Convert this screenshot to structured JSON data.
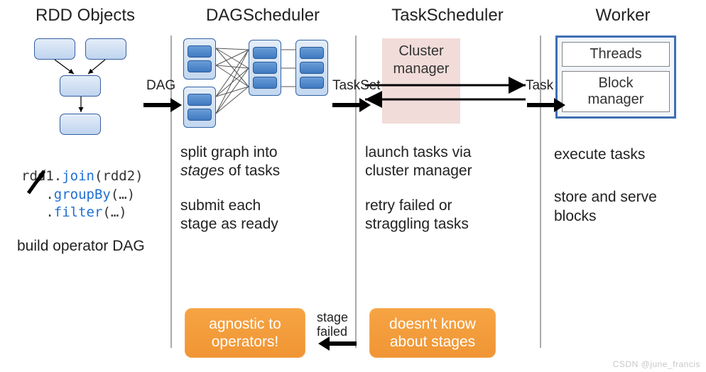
{
  "headers": {
    "rdd": "RDD Objects",
    "dag": "DAGScheduler",
    "task": "TaskScheduler",
    "worker": "Worker"
  },
  "rdd": {
    "code_line1_pre": "rdd1.",
    "code_line1_kw": "join",
    "code_line1_post": "(rdd2)",
    "code_line2_pre": "   .",
    "code_line2_kw": "groupBy",
    "code_line2_post": "(…)",
    "code_line3_pre": "   .",
    "code_line3_kw": "filter",
    "code_line3_post": "(…)",
    "caption": "build operator DAG"
  },
  "transitions": {
    "dag": "DAG",
    "taskset": "TaskSet",
    "task": "Task",
    "stage_failed_l1": "stage",
    "stage_failed_l2": "failed"
  },
  "dag": {
    "text1_l1": "split graph into",
    "text1_l2_em": "stages",
    "text1_l2_post": " of tasks",
    "text2_l1": "submit each",
    "text2_l2": "stage as ready"
  },
  "task": {
    "cluster_l1": "Cluster",
    "cluster_l2": "manager",
    "text1_l1": "launch tasks via",
    "text1_l2": "cluster manager",
    "text2_l1": "retry failed or",
    "text2_l2": "straggling tasks"
  },
  "worker": {
    "threads": "Threads",
    "blockmgr_l1": "Block",
    "blockmgr_l2": "manager",
    "text1": "execute tasks",
    "text2_l1": "store and serve",
    "text2_l2": "blocks"
  },
  "callouts": {
    "c1_l1": "agnostic to",
    "c1_l2": "operators!",
    "c2_l1": "doesn't know",
    "c2_l2": "about stages"
  },
  "watermark": "CSDN @june_francis"
}
